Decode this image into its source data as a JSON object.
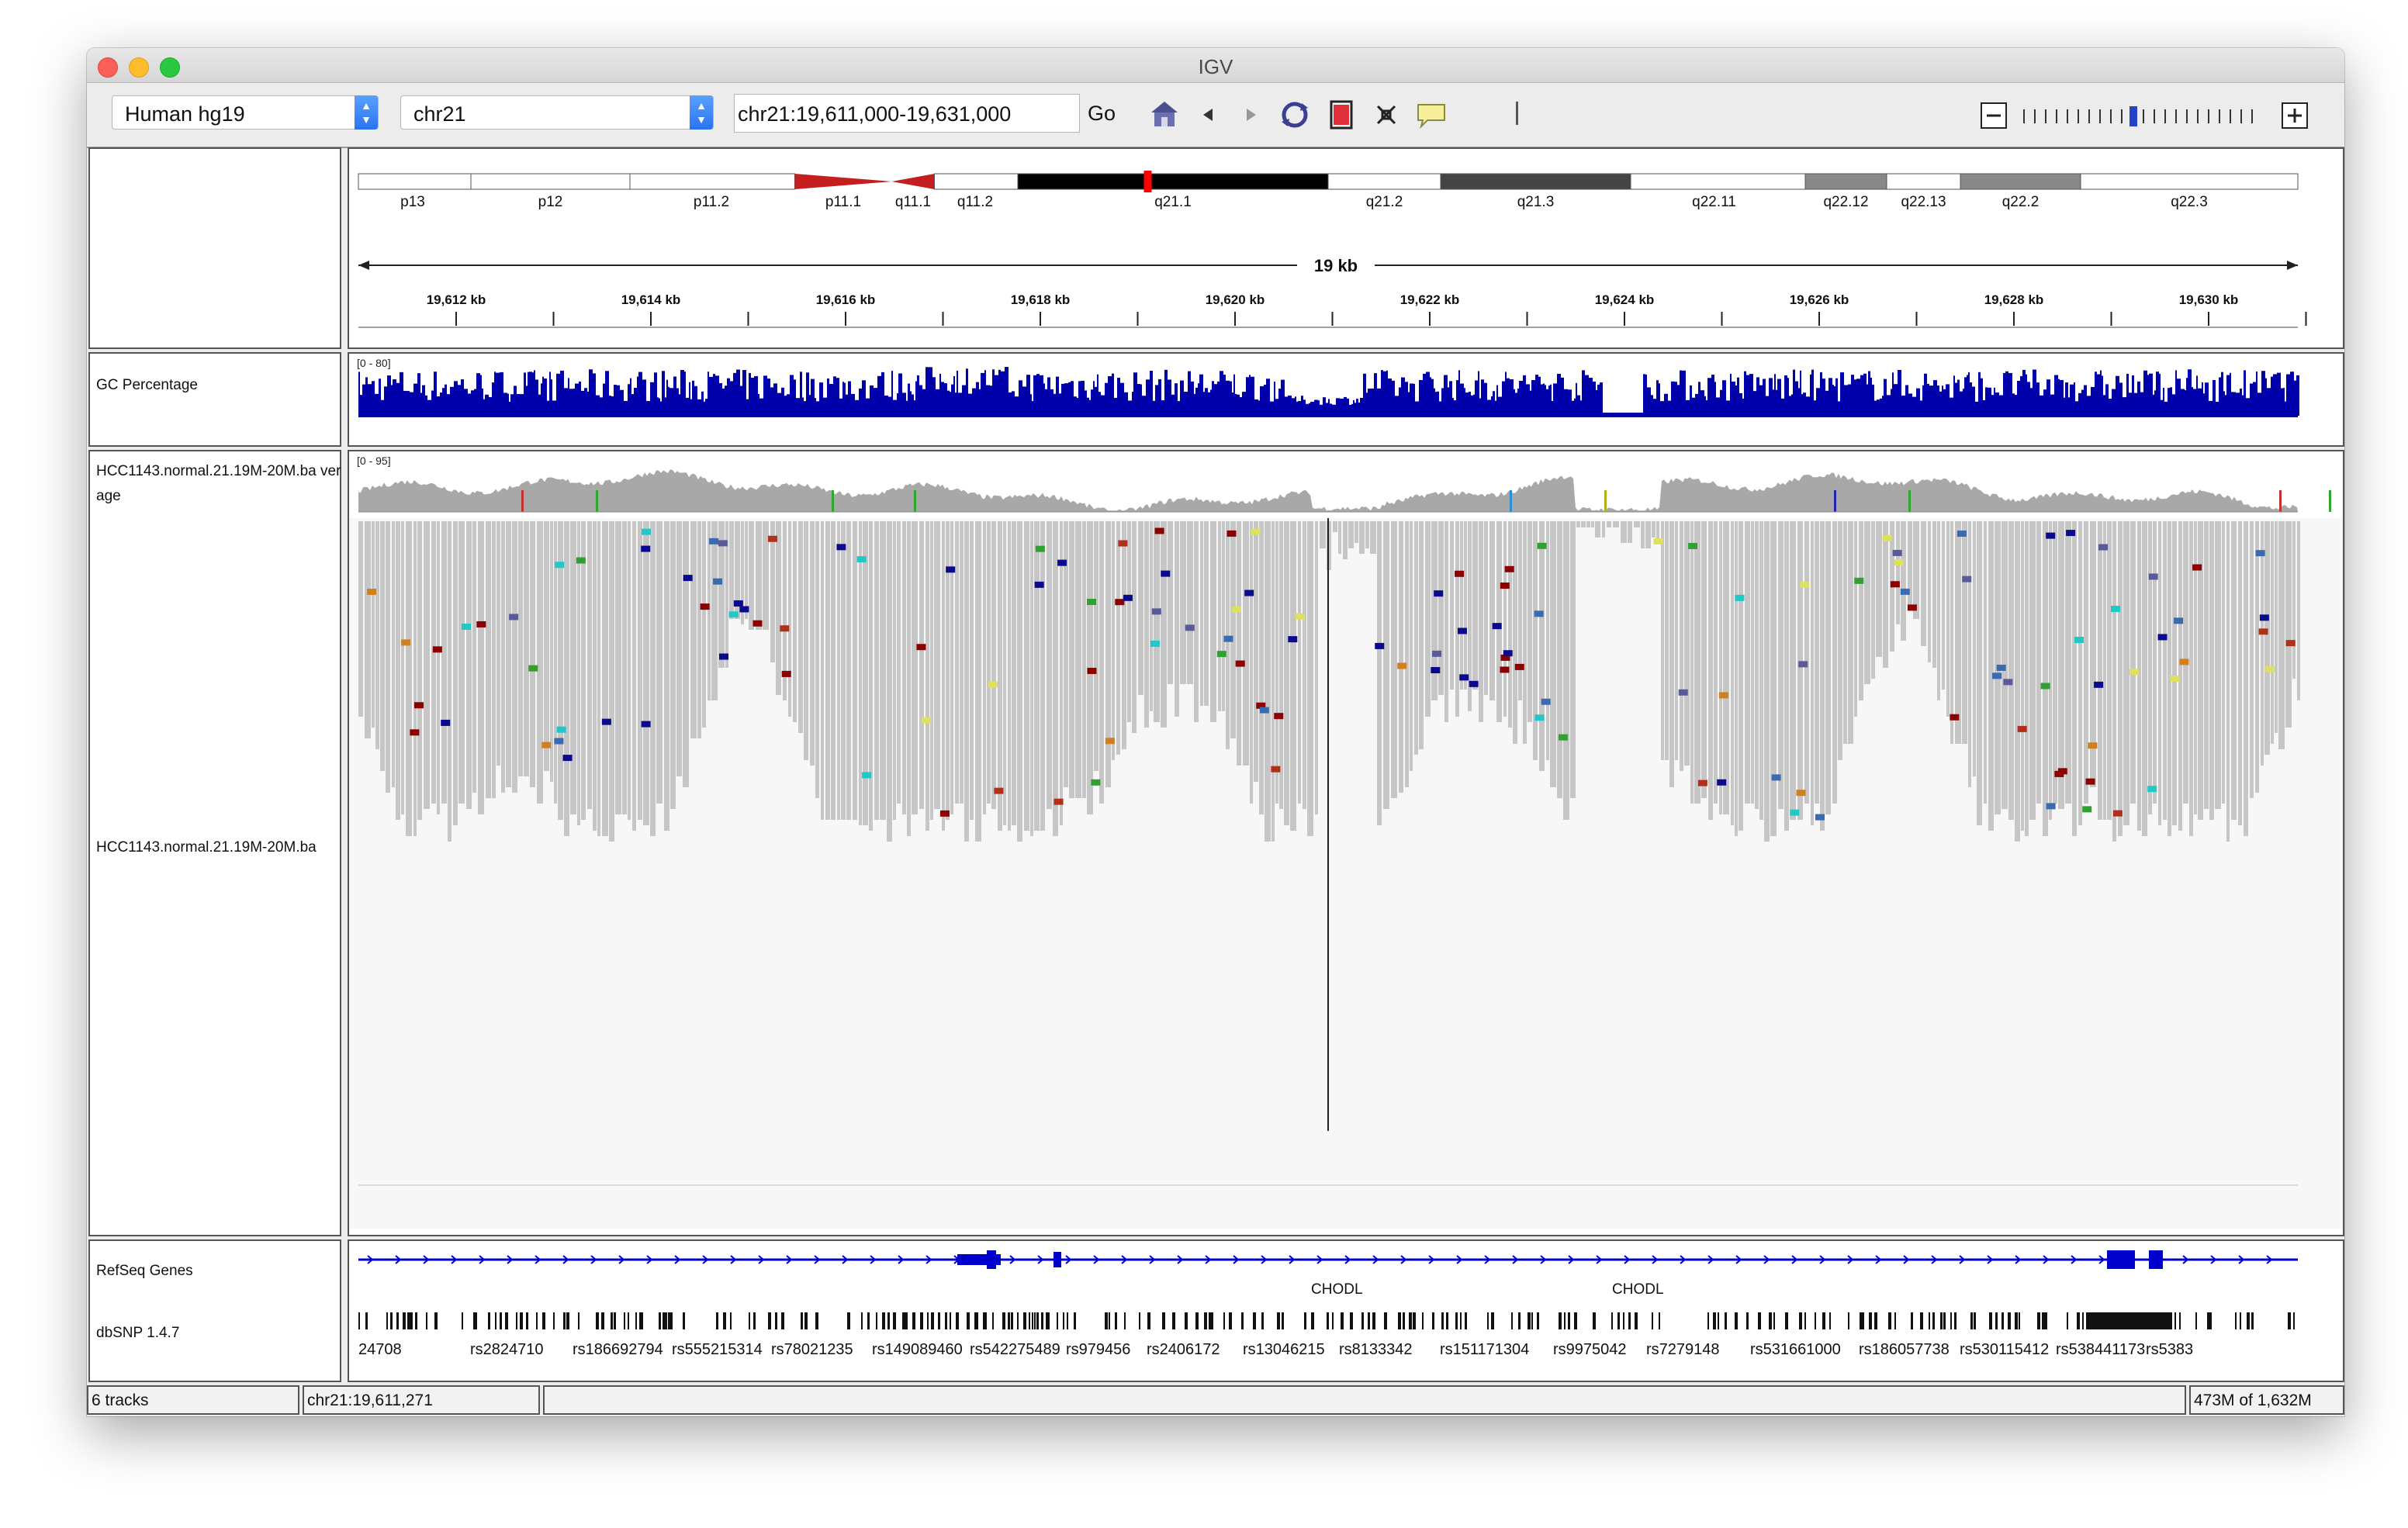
{
  "window": {
    "title": "IGV"
  },
  "toolbar": {
    "genome": "Human hg19",
    "chromosome": "chr21",
    "locus": "chr21:19,611,000-19,631,000",
    "go_label": "Go",
    "icons": [
      "home-icon",
      "back-icon",
      "forward-icon",
      "refresh-icon",
      "roi-icon",
      "resize-icon",
      "popup-text-icon"
    ],
    "zoom_level": 10,
    "zoom_ticks": 22
  },
  "ideogram": {
    "bands": [
      "p13",
      "p12",
      "p11.2",
      "p11.1",
      "q11.1",
      "q11.2",
      "q21.1",
      "q21.2",
      "q21.3",
      "q22.11",
      "q22.12",
      "q22.13",
      "q22.2",
      "q22.3"
    ],
    "highlight_color": "#ff0000"
  },
  "ruler": {
    "span_label": "19 kb",
    "ticks": [
      "19,612 kb",
      "19,614 kb",
      "19,616 kb",
      "19,618 kb",
      "19,620 kb",
      "19,622 kb",
      "19,624 kb",
      "19,626 kb",
      "19,628 kb",
      "19,630 kb"
    ]
  },
  "tracks": {
    "gc": {
      "name": "GC Percentage",
      "range": "[0 - 80]",
      "color": "#0000aa"
    },
    "coverage": {
      "name": "HCC1143.normal.21.19M-20M.ba verage",
      "range": "[0 - 95]",
      "color": "#a8a8a8"
    },
    "alignments": {
      "name": "HCC1143.normal.21.19M-20M.ba",
      "read_color": "#c6c6c6"
    },
    "refseq": {
      "name": "RefSeq Genes",
      "gene_labels": [
        "CHODL",
        "CHODL"
      ],
      "color": "#0000cc"
    },
    "dbsnp": {
      "name": "dbSNP 1.4.7",
      "ids": [
        "24708",
        "rs2824710",
        "rs186692794",
        "rs555215314",
        "rs78021235",
        "rs149089460",
        "rs542275489",
        "rs979456",
        "rs2406172",
        "rs13046215",
        "rs8133342",
        "rs151171304",
        "rs9975042",
        "rs7279148",
        "rs531661000",
        "rs186057738",
        "rs530115412",
        "rs538441173",
        "rs5383"
      ]
    }
  },
  "status_bar": {
    "tracks": "6 tracks",
    "position": "chr21:19,611,271",
    "message": "",
    "memory": "473M of 1,632M"
  }
}
